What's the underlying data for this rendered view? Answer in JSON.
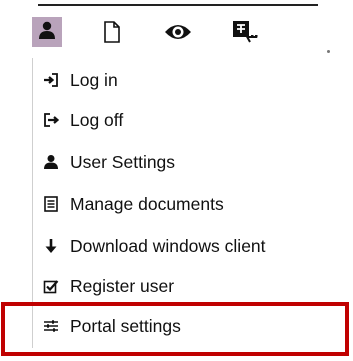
{
  "toolbar": {
    "buttons": [
      {
        "icon": "user-icon"
      },
      {
        "icon": "document-icon"
      },
      {
        "icon": "eye-icon"
      },
      {
        "icon": "translate-icon"
      }
    ]
  },
  "menu": {
    "items": [
      {
        "label": "Log in",
        "icon": "login-icon"
      },
      {
        "label": "Log off",
        "icon": "logout-icon"
      },
      {
        "label": "User Settings",
        "icon": "user-icon"
      },
      {
        "label": "Manage documents",
        "icon": "document-list-icon"
      },
      {
        "label": "Download windows client",
        "icon": "download-arrow-icon"
      },
      {
        "label": "Register user",
        "icon": "checkbox-icon"
      },
      {
        "label": "Portal settings",
        "icon": "sliders-icon"
      }
    ]
  },
  "colors": {
    "highlight": "#c00000",
    "user_button_bg": "#b9a3bb",
    "icon": "#111111"
  }
}
